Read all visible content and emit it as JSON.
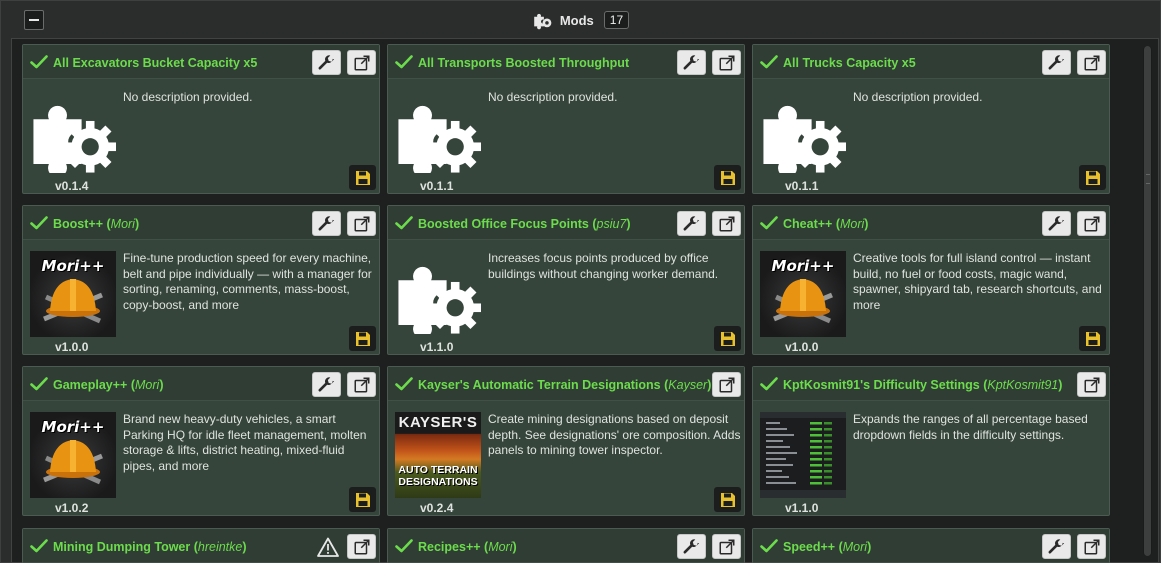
{
  "header": {
    "title": "Mods",
    "count": "17"
  },
  "cards": [
    {
      "title": "All Excavators Bucket Capacity x5",
      "author": "",
      "description": "No description provided.",
      "version": "v0.1.4",
      "thumb": "puzzle-gear",
      "tools": [
        "wrench",
        "open"
      ],
      "save": true
    },
    {
      "title": "All Transports Boosted Throughput",
      "author": "",
      "description": "No description provided.",
      "version": "v0.1.1",
      "thumb": "puzzle-gear",
      "tools": [
        "wrench",
        "open"
      ],
      "save": true
    },
    {
      "title": "All Trucks Capacity x5",
      "author": "",
      "description": "No description provided.",
      "version": "v0.1.1",
      "thumb": "puzzle-gear",
      "tools": [
        "wrench",
        "open"
      ],
      "save": true
    },
    {
      "title": "Boost++",
      "author": "Mori",
      "description": "Fine-tune production speed for every machine, belt and pipe individually — with a manager for sorting, renaming, comments, mass-boost, copy-boost, and more",
      "version": "v1.0.0",
      "thumb": "mori",
      "tools": [
        "wrench",
        "open"
      ],
      "save": true
    },
    {
      "title": "Boosted Office Focus Points",
      "author": "psiu7",
      "description": "Increases focus points produced by office buildings without changing worker demand.",
      "version": "v1.1.0",
      "thumb": "puzzle-gear",
      "tools": [
        "wrench",
        "open"
      ],
      "save": true
    },
    {
      "title": "Cheat++",
      "author": "Mori",
      "description": "Creative tools for full island control — instant build, no fuel or food costs, magic wand, spawner, shipyard tab, research shortcuts, and more",
      "version": "v1.0.0",
      "thumb": "mori",
      "tools": [
        "wrench",
        "open"
      ],
      "save": true
    },
    {
      "title": "Gameplay++",
      "author": "Mori",
      "description": "Brand new heavy-duty vehicles, a smart Parking HQ for idle fleet management, molten storage & lifts, district heating, mixed-fluid pipes, and more",
      "version": "v1.0.2",
      "thumb": "mori",
      "tools": [
        "wrench",
        "open"
      ],
      "save": true
    },
    {
      "title": "Kayser's Automatic Terrain Designations",
      "author": "Kayser",
      "description": "Create mining designations based on deposit depth. See designations' ore composition. Adds panels to mining tower inspector.",
      "version": "v0.2.4",
      "thumb": "kayser",
      "tools": [
        "open"
      ],
      "save": true
    },
    {
      "title": "KptKosmit91's Difficulty Settings",
      "author": "KptKosmit91",
      "description": "Expands the ranges of all percentage based dropdown fields in the difficulty settings.",
      "version": "v1.1.0",
      "thumb": "screenshot",
      "tools": [
        "open"
      ],
      "save": false
    },
    {
      "title": "Mining Dumping Tower",
      "author": "hreintke",
      "description": "",
      "version": "",
      "thumb": "",
      "tools": [
        "warning",
        "open"
      ],
      "save": false
    },
    {
      "title": "Recipes++",
      "author": "Mori",
      "description": "",
      "version": "",
      "thumb": "",
      "tools": [
        "wrench",
        "open"
      ],
      "save": false
    },
    {
      "title": "Speed++",
      "author": "Mori",
      "description": "",
      "version": "",
      "thumb": "",
      "tools": [
        "wrench",
        "open"
      ],
      "save": false
    }
  ],
  "thumb_text": {
    "mori": "Mori++",
    "kayser_top": "KAYSER'S",
    "kayser_bottom": "AUTO TERRAIN DESIGNATIONS"
  },
  "colors": {
    "title_green": "#6ddc4c",
    "card_bg": "#35453b",
    "save_yellow": "#e8c12c"
  },
  "icons": {
    "check": "check-icon",
    "wrench": "wrench-icon",
    "open": "open-external-icon",
    "save": "save-icon",
    "warning": "warning-icon",
    "puzzle": "puzzle-gear-icon"
  }
}
